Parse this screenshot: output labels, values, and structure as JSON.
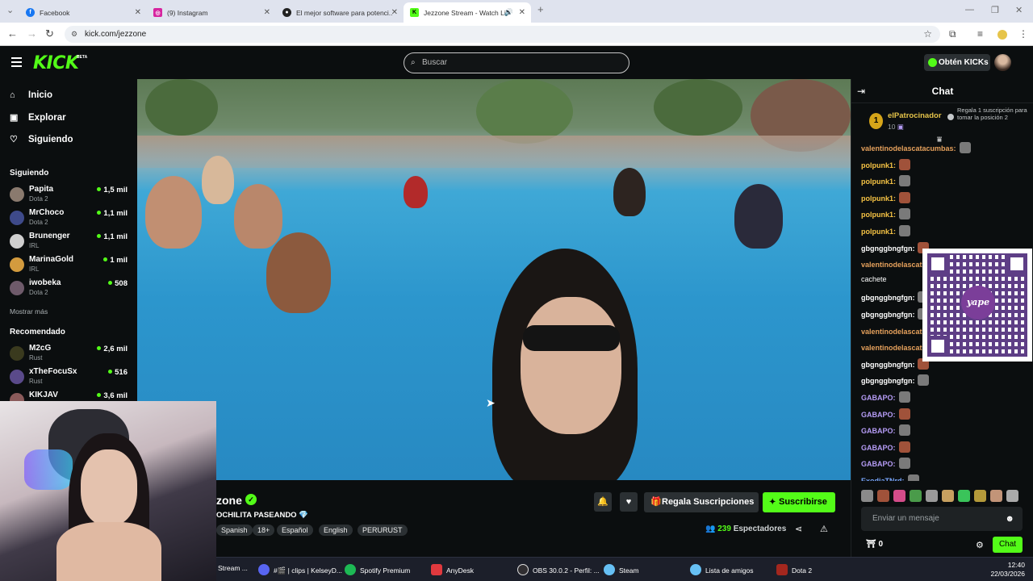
{
  "browser": {
    "tabs": [
      {
        "title": "Facebook",
        "favicon_color": "#1877f2"
      },
      {
        "title": "(9) Instagram",
        "favicon_color": "#d6249f"
      },
      {
        "title": "El mejor software para potenci...",
        "favicon_color": "#222222"
      },
      {
        "title": "Jezzone Stream - Watch Liv",
        "favicon_color": "#53fc18",
        "active": true
      }
    ],
    "url": "kick.com/jezzone"
  },
  "header": {
    "logo": "KICK",
    "logo_badge": "BETA",
    "search_placeholder": "Buscar",
    "get_kicks_label": "Obtén KICKs"
  },
  "sidebar": {
    "nav": [
      {
        "label": "Inicio",
        "icon": "home-icon"
      },
      {
        "label": "Explorar",
        "icon": "compass-icon"
      },
      {
        "label": "Siguiendo",
        "icon": "heart-icon"
      }
    ],
    "following_title": "Siguiendo",
    "following": [
      {
        "name": "Papita",
        "category": "Dota 2",
        "viewers": "1,5 mil"
      },
      {
        "name": "MrChoco",
        "category": "Dota 2",
        "viewers": "1,1 mil"
      },
      {
        "name": "Brunenger",
        "category": "IRL",
        "viewers": "1,1 mil"
      },
      {
        "name": "MarinaGold",
        "category": "IRL",
        "viewers": "1 mil"
      },
      {
        "name": "iwobeka",
        "category": "Dota 2",
        "viewers": "508"
      }
    ],
    "show_more": "Mostrar más",
    "recommended_title": "Recomendado",
    "recommended": [
      {
        "name": "M2cG",
        "category": "Rust",
        "viewers": "2,6 mil"
      },
      {
        "name": "xTheFocuSx",
        "category": "Rust",
        "viewers": "516"
      },
      {
        "name": "KIKJAV",
        "category": "",
        "viewers": "3,6 mil"
      }
    ]
  },
  "stream": {
    "name": "zone",
    "title": "OCHILITA PASEANDO",
    "tags": [
      "Spanish",
      "18+",
      "Español",
      "English",
      "PERURUST"
    ],
    "gift_label": "Regala Suscripciones",
    "subscribe_label": "Suscribirse",
    "viewer_count": "239",
    "viewer_label": "Espectadores"
  },
  "chat": {
    "title": "Chat",
    "pinned": {
      "rank": "1",
      "name": "elPatrocinador",
      "count": "10",
      "gift_text": "Regala 1 suscripción para tomar la posición 2"
    },
    "messages": [
      {
        "user": "valentinodelascatacumbas:",
        "color": "#e6a15c",
        "text": ""
      },
      {
        "user": "polpunk1:",
        "color": "#f6c344",
        "text": ""
      },
      {
        "user": "polpunk1:",
        "color": "#f6c344",
        "text": ""
      },
      {
        "user": "polpunk1:",
        "color": "#f6c344",
        "text": ""
      },
      {
        "user": "polpunk1:",
        "color": "#f6c344",
        "text": ""
      },
      {
        "user": "polpunk1:",
        "color": "#f6c344",
        "text": ""
      },
      {
        "user": "gbgnggbngfgn:",
        "color": "#ffffff",
        "text": ""
      },
      {
        "user": "valentinodelascat",
        "color": "#e6a15c",
        "text": ""
      },
      {
        "user": "",
        "color": "#ffffff",
        "text": "cachete"
      },
      {
        "user": "gbgnggbngfgn:",
        "color": "#ffffff",
        "text": ""
      },
      {
        "user": "gbgnggbngfgn:",
        "color": "#ffffff",
        "text": ""
      },
      {
        "user": "valentinodelascat",
        "color": "#e6a15c",
        "text": ""
      },
      {
        "user": "valentinodelascat",
        "color": "#e6a15c",
        "text": ""
      },
      {
        "user": "gbgnggbngfgn:",
        "color": "#ffffff",
        "text": ""
      },
      {
        "user": "gbgnggbngfgn:",
        "color": "#ffffff",
        "text": ""
      },
      {
        "user": "GABAPO:",
        "color": "#b59cf5",
        "text": ""
      },
      {
        "user": "GABAPO:",
        "color": "#b59cf5",
        "text": ""
      },
      {
        "user": "GABAPO:",
        "color": "#b59cf5",
        "text": ""
      },
      {
        "user": "GABAPO:",
        "color": "#b59cf5",
        "text": ""
      },
      {
        "user": "GABAPO:",
        "color": "#b59cf5",
        "text": ""
      },
      {
        "user": "ExodiaTNrd:",
        "color": "#7aa8ff",
        "text": ""
      }
    ],
    "qr_label": "yape",
    "input_placeholder": "Enviar un mensaje",
    "kicks_count": "0",
    "send_label": "Chat"
  },
  "taskbar": {
    "items": [
      {
        "label": "Stream ...",
        "color": "#3a3f55"
      },
      {
        "label": "#🎬 | clips | KelseyD...",
        "color": "#5865f2"
      },
      {
        "label": "Spotify Premium",
        "color": "#1db954"
      },
      {
        "label": "AnyDesk",
        "color": "#e0393e"
      },
      {
        "label": "OBS 30.0.2 - Perfil: ...",
        "color": "#302e31"
      },
      {
        "label": "Steam",
        "color": "#1b2838"
      },
      {
        "label": "Lista de amigos",
        "color": "#2a475e"
      },
      {
        "label": "Dota 2",
        "color": "#a3271e"
      }
    ],
    "time": "12:40",
    "date": "22/03/2026"
  }
}
